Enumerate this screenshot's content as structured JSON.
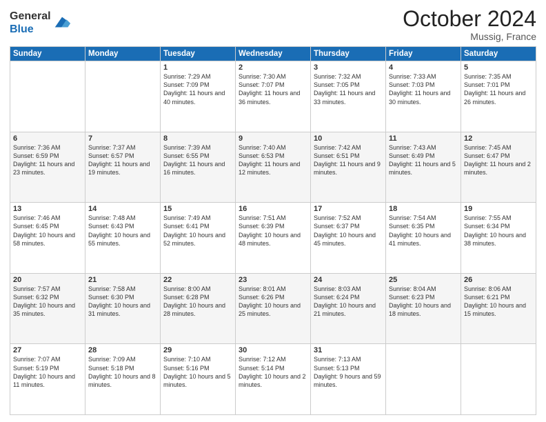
{
  "logo": {
    "general": "General",
    "blue": "Blue"
  },
  "header": {
    "month": "October 2024",
    "location": "Mussig, France"
  },
  "days_of_week": [
    "Sunday",
    "Monday",
    "Tuesday",
    "Wednesday",
    "Thursday",
    "Friday",
    "Saturday"
  ],
  "weeks": [
    [
      {
        "day": "",
        "info": ""
      },
      {
        "day": "",
        "info": ""
      },
      {
        "day": "1",
        "info": "Sunrise: 7:29 AM\nSunset: 7:09 PM\nDaylight: 11 hours and 40 minutes."
      },
      {
        "day": "2",
        "info": "Sunrise: 7:30 AM\nSunset: 7:07 PM\nDaylight: 11 hours and 36 minutes."
      },
      {
        "day": "3",
        "info": "Sunrise: 7:32 AM\nSunset: 7:05 PM\nDaylight: 11 hours and 33 minutes."
      },
      {
        "day": "4",
        "info": "Sunrise: 7:33 AM\nSunset: 7:03 PM\nDaylight: 11 hours and 30 minutes."
      },
      {
        "day": "5",
        "info": "Sunrise: 7:35 AM\nSunset: 7:01 PM\nDaylight: 11 hours and 26 minutes."
      }
    ],
    [
      {
        "day": "6",
        "info": "Sunrise: 7:36 AM\nSunset: 6:59 PM\nDaylight: 11 hours and 23 minutes."
      },
      {
        "day": "7",
        "info": "Sunrise: 7:37 AM\nSunset: 6:57 PM\nDaylight: 11 hours and 19 minutes."
      },
      {
        "day": "8",
        "info": "Sunrise: 7:39 AM\nSunset: 6:55 PM\nDaylight: 11 hours and 16 minutes."
      },
      {
        "day": "9",
        "info": "Sunrise: 7:40 AM\nSunset: 6:53 PM\nDaylight: 11 hours and 12 minutes."
      },
      {
        "day": "10",
        "info": "Sunrise: 7:42 AM\nSunset: 6:51 PM\nDaylight: 11 hours and 9 minutes."
      },
      {
        "day": "11",
        "info": "Sunrise: 7:43 AM\nSunset: 6:49 PM\nDaylight: 11 hours and 5 minutes."
      },
      {
        "day": "12",
        "info": "Sunrise: 7:45 AM\nSunset: 6:47 PM\nDaylight: 11 hours and 2 minutes."
      }
    ],
    [
      {
        "day": "13",
        "info": "Sunrise: 7:46 AM\nSunset: 6:45 PM\nDaylight: 10 hours and 58 minutes."
      },
      {
        "day": "14",
        "info": "Sunrise: 7:48 AM\nSunset: 6:43 PM\nDaylight: 10 hours and 55 minutes."
      },
      {
        "day": "15",
        "info": "Sunrise: 7:49 AM\nSunset: 6:41 PM\nDaylight: 10 hours and 52 minutes."
      },
      {
        "day": "16",
        "info": "Sunrise: 7:51 AM\nSunset: 6:39 PM\nDaylight: 10 hours and 48 minutes."
      },
      {
        "day": "17",
        "info": "Sunrise: 7:52 AM\nSunset: 6:37 PM\nDaylight: 10 hours and 45 minutes."
      },
      {
        "day": "18",
        "info": "Sunrise: 7:54 AM\nSunset: 6:35 PM\nDaylight: 10 hours and 41 minutes."
      },
      {
        "day": "19",
        "info": "Sunrise: 7:55 AM\nSunset: 6:34 PM\nDaylight: 10 hours and 38 minutes."
      }
    ],
    [
      {
        "day": "20",
        "info": "Sunrise: 7:57 AM\nSunset: 6:32 PM\nDaylight: 10 hours and 35 minutes."
      },
      {
        "day": "21",
        "info": "Sunrise: 7:58 AM\nSunset: 6:30 PM\nDaylight: 10 hours and 31 minutes."
      },
      {
        "day": "22",
        "info": "Sunrise: 8:00 AM\nSunset: 6:28 PM\nDaylight: 10 hours and 28 minutes."
      },
      {
        "day": "23",
        "info": "Sunrise: 8:01 AM\nSunset: 6:26 PM\nDaylight: 10 hours and 25 minutes."
      },
      {
        "day": "24",
        "info": "Sunrise: 8:03 AM\nSunset: 6:24 PM\nDaylight: 10 hours and 21 minutes."
      },
      {
        "day": "25",
        "info": "Sunrise: 8:04 AM\nSunset: 6:23 PM\nDaylight: 10 hours and 18 minutes."
      },
      {
        "day": "26",
        "info": "Sunrise: 8:06 AM\nSunset: 6:21 PM\nDaylight: 10 hours and 15 minutes."
      }
    ],
    [
      {
        "day": "27",
        "info": "Sunrise: 7:07 AM\nSunset: 5:19 PM\nDaylight: 10 hours and 11 minutes."
      },
      {
        "day": "28",
        "info": "Sunrise: 7:09 AM\nSunset: 5:18 PM\nDaylight: 10 hours and 8 minutes."
      },
      {
        "day": "29",
        "info": "Sunrise: 7:10 AM\nSunset: 5:16 PM\nDaylight: 10 hours and 5 minutes."
      },
      {
        "day": "30",
        "info": "Sunrise: 7:12 AM\nSunset: 5:14 PM\nDaylight: 10 hours and 2 minutes."
      },
      {
        "day": "31",
        "info": "Sunrise: 7:13 AM\nSunset: 5:13 PM\nDaylight: 9 hours and 59 minutes."
      },
      {
        "day": "",
        "info": ""
      },
      {
        "day": "",
        "info": ""
      }
    ]
  ]
}
